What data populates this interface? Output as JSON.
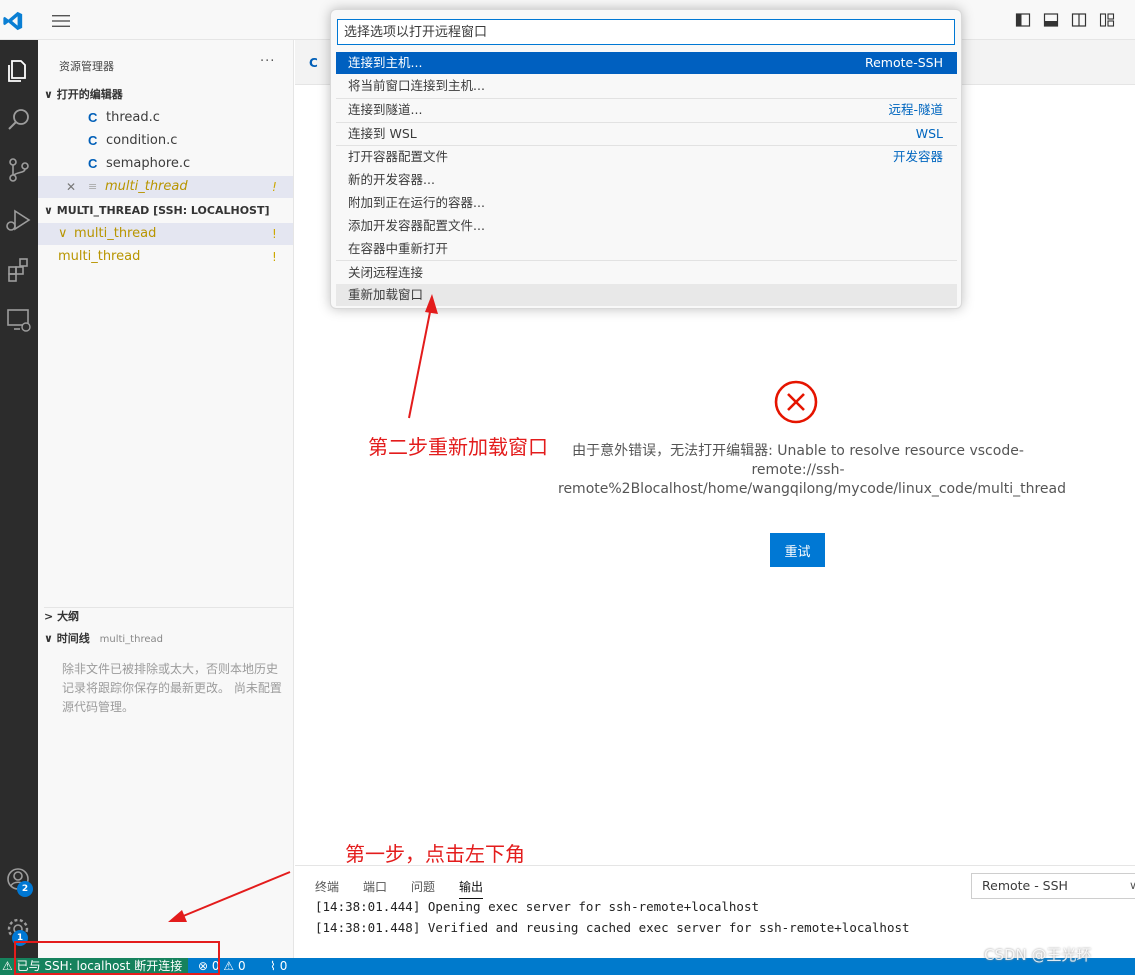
{
  "command_palette": {
    "placeholder": "选择选项以打开远程窗口",
    "items": [
      {
        "label": "连接到主机...",
        "detail": "Remote-SSH"
      },
      {
        "label": "将当前窗口连接到主机...",
        "detail": ""
      },
      {
        "label": "连接到隧道...",
        "detail": "远程-隧道"
      },
      {
        "label": "连接到 WSL",
        "detail": "WSL"
      },
      {
        "label": "打开容器配置文件",
        "detail": "开发容器"
      },
      {
        "label": "新的开发容器...",
        "detail": ""
      },
      {
        "label": "附加到正在运行的容器...",
        "detail": ""
      },
      {
        "label": "添加开发容器配置文件...",
        "detail": ""
      },
      {
        "label": "在容器中重新打开",
        "detail": ""
      },
      {
        "label": "关闭远程连接",
        "detail": ""
      },
      {
        "label": "重新加载窗口",
        "detail": ""
      }
    ]
  },
  "sidebar": {
    "title": "资源管理器",
    "more": "···",
    "open_editors_header": "打开的编辑器",
    "open_editors": [
      "thread.c",
      "condition.c",
      "semaphore.c",
      "multi_thread"
    ],
    "folder_header": "MULTI_THREAD [SSH: LOCALHOST]",
    "folder_items": [
      "multi_thread",
      "multi_thread"
    ],
    "warning_mark": "!",
    "outline_header": "大纲",
    "timeline_header": "时间线",
    "timeline_sub": "multi_thread",
    "timeline_message": "除非文件已被排除或太大，否则本地历史记录将跟踪你保存的最新更改。 尚未配置源代码管理。"
  },
  "editor": {
    "tab_icon_letter": "C",
    "error_message": "由于意外错误，无法打开编辑器: Unable to resolve resource vscode-remote://ssh-remote%2Blocalhost/home/wangqilong/mycode/linux_code/multi_thread",
    "retry_label": "重试"
  },
  "annotations": {
    "step1": "第一步，点击左下角",
    "step2": "第二步重新加载窗口"
  },
  "panel": {
    "tabs": [
      "终端",
      "端口",
      "问题",
      "输出"
    ],
    "active_tab": "输出",
    "output_channel": "Remote - SSH",
    "log": [
      "[14:38:01.444] Opening exec server for ssh-remote+localhost",
      "[14:38:01.448] Verified and reusing cached exec server for ssh-remote+localhost"
    ]
  },
  "statusbar": {
    "remote": "已与 SSH: localhost 断开连接",
    "errors": "0",
    "warnings": "0",
    "ports": "0"
  },
  "badges": {
    "accounts": "2",
    "manage": "1"
  },
  "watermark": "CSDN @王光环",
  "colors": {
    "accent": "#0078d4",
    "status_bar": "#007acc",
    "remote_indicator": "#16825d",
    "annotation_red": "#e31c1c",
    "activity_bar": "#2c2c2c",
    "warning": "#cca700"
  }
}
